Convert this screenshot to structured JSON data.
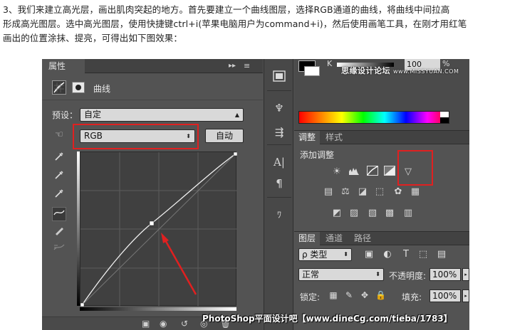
{
  "tutorial": {
    "line1": "3、我们来建立高光层，画出肌肉突起的地方。首先要建立一个曲线图层，选择RGB通道的曲线，将曲线中间拉高",
    "line2": "形成高光图层。选中高光图层，使用快捷键ctrl+i(苹果电脑用户为command+i)，然后使用画笔工具，在刚才用红笔",
    "line3": "画出的位置涂抹、提亮，可得出如下图效果："
  },
  "properties": {
    "tab": "属性",
    "collapse": "▸▸",
    "menu": "≡",
    "title": "曲线",
    "preset_label": "预设：",
    "preset_value": "自定",
    "channel_value": "RGB",
    "auto_button": "自动"
  },
  "swatches": {
    "k_label": "K",
    "k_value": "100",
    "percent": "%",
    "watermark": "思缘设计论坛",
    "watermark_url": "www.MISSYUAN.COM"
  },
  "adjustments": {
    "tab_active": "调整",
    "tab_inactive": "样式",
    "title": "添加调整"
  },
  "layers": {
    "tab_layers": "图层",
    "tab_channels": "通道",
    "tab_paths": "路径",
    "filter_label": "ρ 类型",
    "blend_mode": "正常",
    "opacity_label": "不透明度:",
    "opacity_value": "100%",
    "lock_label": "锁定:",
    "fill_label": "填充:",
    "fill_value": "100%"
  },
  "footer_watermark": "PhotoShop平面设计吧【www.dineCg.com/tieba/1783】",
  "colors": {
    "highlight_red": "#e02020",
    "panel_bg": "#535353",
    "panel_dark": "#424242"
  }
}
